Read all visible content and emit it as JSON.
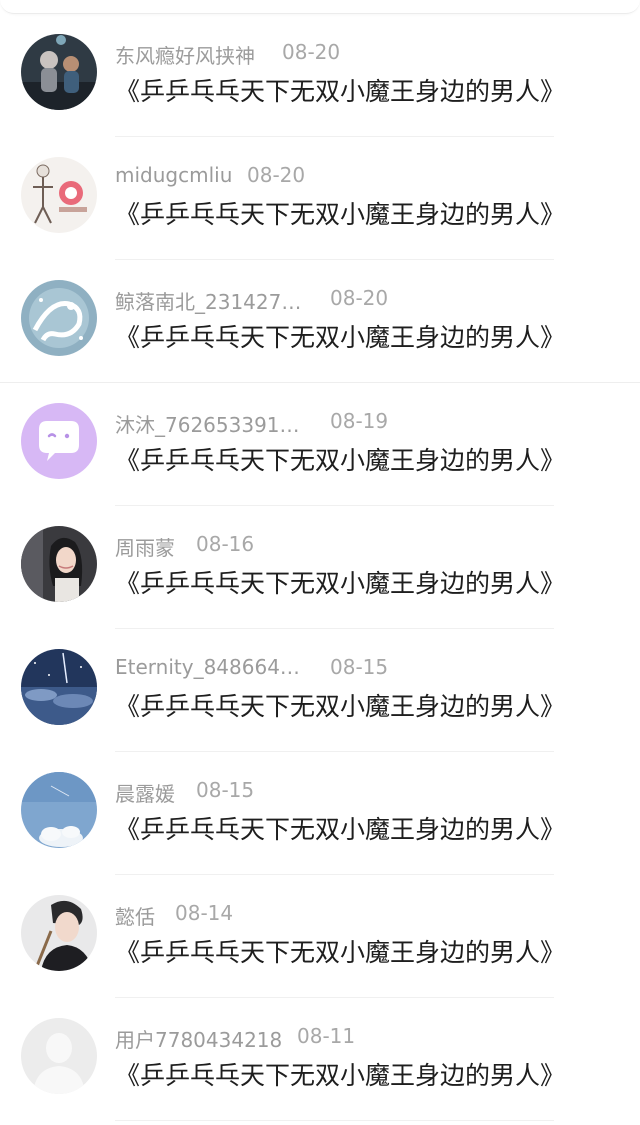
{
  "notifications": [
    {
      "user": "东风瘾好风挟神",
      "date": "08-20",
      "title": "《乒乒乓乓天下无双小魔王身边的男人》",
      "avatar_icon": "avatar-anime-figures"
    },
    {
      "user": "midugcmliu",
      "date": "08-20",
      "title": "《乒乒乓乓天下无双小魔王身边的男人》",
      "avatar_icon": "avatar-skeleton-doll"
    },
    {
      "user": "鲸落南北_231427…",
      "date": "08-20",
      "title": "《乒乒乓乓天下无双小魔王身边的男人》",
      "avatar_icon": "avatar-white-dragon"
    },
    {
      "user": "沐沐_762653391…",
      "date": "08-19",
      "title": "《乒乒乓乓天下无双小魔王身边的男人》",
      "avatar_icon": "avatar-chat-bubble-purple"
    },
    {
      "user": "周雨蒙",
      "date": "08-16",
      "title": "《乒乒乓乓天下无双小魔王身边的男人》",
      "avatar_icon": "avatar-woman-photo"
    },
    {
      "user": "Eternity_848664…",
      "date": "08-15",
      "title": "《乒乒乓乓天下无双小魔王身边的男人》",
      "avatar_icon": "avatar-night-sky"
    },
    {
      "user": "晨露媛",
      "date": "08-15",
      "title": "《乒乒乓乓天下无双小魔王身边的男人》",
      "avatar_icon": "avatar-blue-sky-cloud"
    },
    {
      "user": "懿佸",
      "date": "08-14",
      "title": "《乒乒乓乓天下无双小魔王身边的男人》",
      "avatar_icon": "avatar-man-photo"
    },
    {
      "user": "用户7780434218",
      "date": "08-11",
      "title": "《乒乒乓乓天下无双小魔王身边的男人》",
      "avatar_icon": "avatar-default-placeholder"
    }
  ],
  "colors": {
    "name_text": "#9b9b9b",
    "title_text": "#1e1e1e",
    "divider": "#f0f0f0",
    "avatar_purple": "#d7b8f5"
  }
}
